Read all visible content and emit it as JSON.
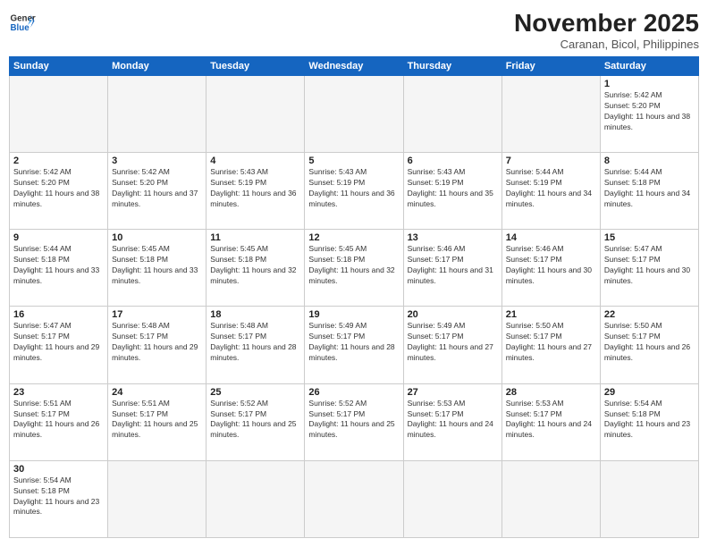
{
  "header": {
    "logo_general": "General",
    "logo_blue": "Blue",
    "month_title": "November 2025",
    "location": "Caranan, Bicol, Philippines"
  },
  "weekdays": [
    "Sunday",
    "Monday",
    "Tuesday",
    "Wednesday",
    "Thursday",
    "Friday",
    "Saturday"
  ],
  "days": [
    {
      "date": "",
      "sunrise": "",
      "sunset": "",
      "daylight": ""
    },
    {
      "date": "",
      "sunrise": "",
      "sunset": "",
      "daylight": ""
    },
    {
      "date": "",
      "sunrise": "",
      "sunset": "",
      "daylight": ""
    },
    {
      "date": "",
      "sunrise": "",
      "sunset": "",
      "daylight": ""
    },
    {
      "date": "",
      "sunrise": "",
      "sunset": "",
      "daylight": ""
    },
    {
      "date": "",
      "sunrise": "",
      "sunset": "",
      "daylight": ""
    },
    {
      "date": "1",
      "sunrise": "Sunrise: 5:42 AM",
      "sunset": "Sunset: 5:20 PM",
      "daylight": "Daylight: 11 hours and 38 minutes."
    },
    {
      "date": "2",
      "sunrise": "Sunrise: 5:42 AM",
      "sunset": "Sunset: 5:20 PM",
      "daylight": "Daylight: 11 hours and 38 minutes."
    },
    {
      "date": "3",
      "sunrise": "Sunrise: 5:42 AM",
      "sunset": "Sunset: 5:20 PM",
      "daylight": "Daylight: 11 hours and 37 minutes."
    },
    {
      "date": "4",
      "sunrise": "Sunrise: 5:43 AM",
      "sunset": "Sunset: 5:19 PM",
      "daylight": "Daylight: 11 hours and 36 minutes."
    },
    {
      "date": "5",
      "sunrise": "Sunrise: 5:43 AM",
      "sunset": "Sunset: 5:19 PM",
      "daylight": "Daylight: 11 hours and 36 minutes."
    },
    {
      "date": "6",
      "sunrise": "Sunrise: 5:43 AM",
      "sunset": "Sunset: 5:19 PM",
      "daylight": "Daylight: 11 hours and 35 minutes."
    },
    {
      "date": "7",
      "sunrise": "Sunrise: 5:44 AM",
      "sunset": "Sunset: 5:19 PM",
      "daylight": "Daylight: 11 hours and 34 minutes."
    },
    {
      "date": "8",
      "sunrise": "Sunrise: 5:44 AM",
      "sunset": "Sunset: 5:18 PM",
      "daylight": "Daylight: 11 hours and 34 minutes."
    },
    {
      "date": "9",
      "sunrise": "Sunrise: 5:44 AM",
      "sunset": "Sunset: 5:18 PM",
      "daylight": "Daylight: 11 hours and 33 minutes."
    },
    {
      "date": "10",
      "sunrise": "Sunrise: 5:45 AM",
      "sunset": "Sunset: 5:18 PM",
      "daylight": "Daylight: 11 hours and 33 minutes."
    },
    {
      "date": "11",
      "sunrise": "Sunrise: 5:45 AM",
      "sunset": "Sunset: 5:18 PM",
      "daylight": "Daylight: 11 hours and 32 minutes."
    },
    {
      "date": "12",
      "sunrise": "Sunrise: 5:45 AM",
      "sunset": "Sunset: 5:18 PM",
      "daylight": "Daylight: 11 hours and 32 minutes."
    },
    {
      "date": "13",
      "sunrise": "Sunrise: 5:46 AM",
      "sunset": "Sunset: 5:17 PM",
      "daylight": "Daylight: 11 hours and 31 minutes."
    },
    {
      "date": "14",
      "sunrise": "Sunrise: 5:46 AM",
      "sunset": "Sunset: 5:17 PM",
      "daylight": "Daylight: 11 hours and 30 minutes."
    },
    {
      "date": "15",
      "sunrise": "Sunrise: 5:47 AM",
      "sunset": "Sunset: 5:17 PM",
      "daylight": "Daylight: 11 hours and 30 minutes."
    },
    {
      "date": "16",
      "sunrise": "Sunrise: 5:47 AM",
      "sunset": "Sunset: 5:17 PM",
      "daylight": "Daylight: 11 hours and 29 minutes."
    },
    {
      "date": "17",
      "sunrise": "Sunrise: 5:48 AM",
      "sunset": "Sunset: 5:17 PM",
      "daylight": "Daylight: 11 hours and 29 minutes."
    },
    {
      "date": "18",
      "sunrise": "Sunrise: 5:48 AM",
      "sunset": "Sunset: 5:17 PM",
      "daylight": "Daylight: 11 hours and 28 minutes."
    },
    {
      "date": "19",
      "sunrise": "Sunrise: 5:49 AM",
      "sunset": "Sunset: 5:17 PM",
      "daylight": "Daylight: 11 hours and 28 minutes."
    },
    {
      "date": "20",
      "sunrise": "Sunrise: 5:49 AM",
      "sunset": "Sunset: 5:17 PM",
      "daylight": "Daylight: 11 hours and 27 minutes."
    },
    {
      "date": "21",
      "sunrise": "Sunrise: 5:50 AM",
      "sunset": "Sunset: 5:17 PM",
      "daylight": "Daylight: 11 hours and 27 minutes."
    },
    {
      "date": "22",
      "sunrise": "Sunrise: 5:50 AM",
      "sunset": "Sunset: 5:17 PM",
      "daylight": "Daylight: 11 hours and 26 minutes."
    },
    {
      "date": "23",
      "sunrise": "Sunrise: 5:51 AM",
      "sunset": "Sunset: 5:17 PM",
      "daylight": "Daylight: 11 hours and 26 minutes."
    },
    {
      "date": "24",
      "sunrise": "Sunrise: 5:51 AM",
      "sunset": "Sunset: 5:17 PM",
      "daylight": "Daylight: 11 hours and 25 minutes."
    },
    {
      "date": "25",
      "sunrise": "Sunrise: 5:52 AM",
      "sunset": "Sunset: 5:17 PM",
      "daylight": "Daylight: 11 hours and 25 minutes."
    },
    {
      "date": "26",
      "sunrise": "Sunrise: 5:52 AM",
      "sunset": "Sunset: 5:17 PM",
      "daylight": "Daylight: 11 hours and 25 minutes."
    },
    {
      "date": "27",
      "sunrise": "Sunrise: 5:53 AM",
      "sunset": "Sunset: 5:17 PM",
      "daylight": "Daylight: 11 hours and 24 minutes."
    },
    {
      "date": "28",
      "sunrise": "Sunrise: 5:53 AM",
      "sunset": "Sunset: 5:17 PM",
      "daylight": "Daylight: 11 hours and 24 minutes."
    },
    {
      "date": "29",
      "sunrise": "Sunrise: 5:54 AM",
      "sunset": "Sunset: 5:18 PM",
      "daylight": "Daylight: 11 hours and 23 minutes."
    },
    {
      "date": "30",
      "sunrise": "Sunrise: 5:54 AM",
      "sunset": "Sunset: 5:18 PM",
      "daylight": "Daylight: 11 hours and 23 minutes."
    }
  ]
}
